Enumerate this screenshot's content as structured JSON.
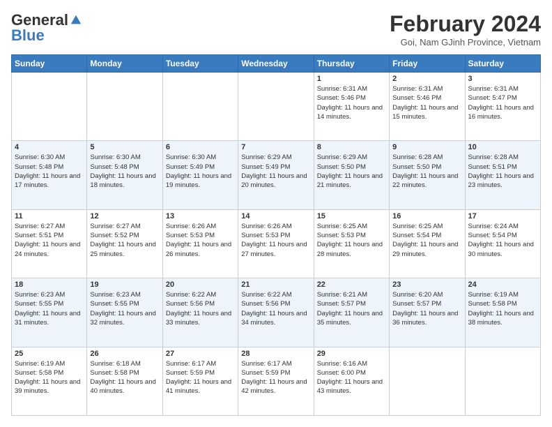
{
  "header": {
    "logo": {
      "general": "General",
      "blue": "Blue",
      "tagline": ""
    },
    "title": "February 2024",
    "subtitle": "Goi, Nam GJinh Province, Vietnam"
  },
  "weekdays": [
    "Sunday",
    "Monday",
    "Tuesday",
    "Wednesday",
    "Thursday",
    "Friday",
    "Saturday"
  ],
  "weeks": [
    [
      {
        "day": "",
        "info": ""
      },
      {
        "day": "",
        "info": ""
      },
      {
        "day": "",
        "info": ""
      },
      {
        "day": "",
        "info": ""
      },
      {
        "day": "1",
        "info": "Sunrise: 6:31 AM\nSunset: 5:46 PM\nDaylight: 11 hours and 14 minutes."
      },
      {
        "day": "2",
        "info": "Sunrise: 6:31 AM\nSunset: 5:46 PM\nDaylight: 11 hours and 15 minutes."
      },
      {
        "day": "3",
        "info": "Sunrise: 6:31 AM\nSunset: 5:47 PM\nDaylight: 11 hours and 16 minutes."
      }
    ],
    [
      {
        "day": "4",
        "info": "Sunrise: 6:30 AM\nSunset: 5:48 PM\nDaylight: 11 hours and 17 minutes."
      },
      {
        "day": "5",
        "info": "Sunrise: 6:30 AM\nSunset: 5:48 PM\nDaylight: 11 hours and 18 minutes."
      },
      {
        "day": "6",
        "info": "Sunrise: 6:30 AM\nSunset: 5:49 PM\nDaylight: 11 hours and 19 minutes."
      },
      {
        "day": "7",
        "info": "Sunrise: 6:29 AM\nSunset: 5:49 PM\nDaylight: 11 hours and 20 minutes."
      },
      {
        "day": "8",
        "info": "Sunrise: 6:29 AM\nSunset: 5:50 PM\nDaylight: 11 hours and 21 minutes."
      },
      {
        "day": "9",
        "info": "Sunrise: 6:28 AM\nSunset: 5:50 PM\nDaylight: 11 hours and 22 minutes."
      },
      {
        "day": "10",
        "info": "Sunrise: 6:28 AM\nSunset: 5:51 PM\nDaylight: 11 hours and 23 minutes."
      }
    ],
    [
      {
        "day": "11",
        "info": "Sunrise: 6:27 AM\nSunset: 5:51 PM\nDaylight: 11 hours and 24 minutes."
      },
      {
        "day": "12",
        "info": "Sunrise: 6:27 AM\nSunset: 5:52 PM\nDaylight: 11 hours and 25 minutes."
      },
      {
        "day": "13",
        "info": "Sunrise: 6:26 AM\nSunset: 5:53 PM\nDaylight: 11 hours and 26 minutes."
      },
      {
        "day": "14",
        "info": "Sunrise: 6:26 AM\nSunset: 5:53 PM\nDaylight: 11 hours and 27 minutes."
      },
      {
        "day": "15",
        "info": "Sunrise: 6:25 AM\nSunset: 5:53 PM\nDaylight: 11 hours and 28 minutes."
      },
      {
        "day": "16",
        "info": "Sunrise: 6:25 AM\nSunset: 5:54 PM\nDaylight: 11 hours and 29 minutes."
      },
      {
        "day": "17",
        "info": "Sunrise: 6:24 AM\nSunset: 5:54 PM\nDaylight: 11 hours and 30 minutes."
      }
    ],
    [
      {
        "day": "18",
        "info": "Sunrise: 6:23 AM\nSunset: 5:55 PM\nDaylight: 11 hours and 31 minutes."
      },
      {
        "day": "19",
        "info": "Sunrise: 6:23 AM\nSunset: 5:55 PM\nDaylight: 11 hours and 32 minutes."
      },
      {
        "day": "20",
        "info": "Sunrise: 6:22 AM\nSunset: 5:56 PM\nDaylight: 11 hours and 33 minutes."
      },
      {
        "day": "21",
        "info": "Sunrise: 6:22 AM\nSunset: 5:56 PM\nDaylight: 11 hours and 34 minutes."
      },
      {
        "day": "22",
        "info": "Sunrise: 6:21 AM\nSunset: 5:57 PM\nDaylight: 11 hours and 35 minutes."
      },
      {
        "day": "23",
        "info": "Sunrise: 6:20 AM\nSunset: 5:57 PM\nDaylight: 11 hours and 36 minutes."
      },
      {
        "day": "24",
        "info": "Sunrise: 6:19 AM\nSunset: 5:58 PM\nDaylight: 11 hours and 38 minutes."
      }
    ],
    [
      {
        "day": "25",
        "info": "Sunrise: 6:19 AM\nSunset: 5:58 PM\nDaylight: 11 hours and 39 minutes."
      },
      {
        "day": "26",
        "info": "Sunrise: 6:18 AM\nSunset: 5:58 PM\nDaylight: 11 hours and 40 minutes."
      },
      {
        "day": "27",
        "info": "Sunrise: 6:17 AM\nSunset: 5:59 PM\nDaylight: 11 hours and 41 minutes."
      },
      {
        "day": "28",
        "info": "Sunrise: 6:17 AM\nSunset: 5:59 PM\nDaylight: 11 hours and 42 minutes."
      },
      {
        "day": "29",
        "info": "Sunrise: 6:16 AM\nSunset: 6:00 PM\nDaylight: 11 hours and 43 minutes."
      },
      {
        "day": "",
        "info": ""
      },
      {
        "day": "",
        "info": ""
      }
    ]
  ]
}
